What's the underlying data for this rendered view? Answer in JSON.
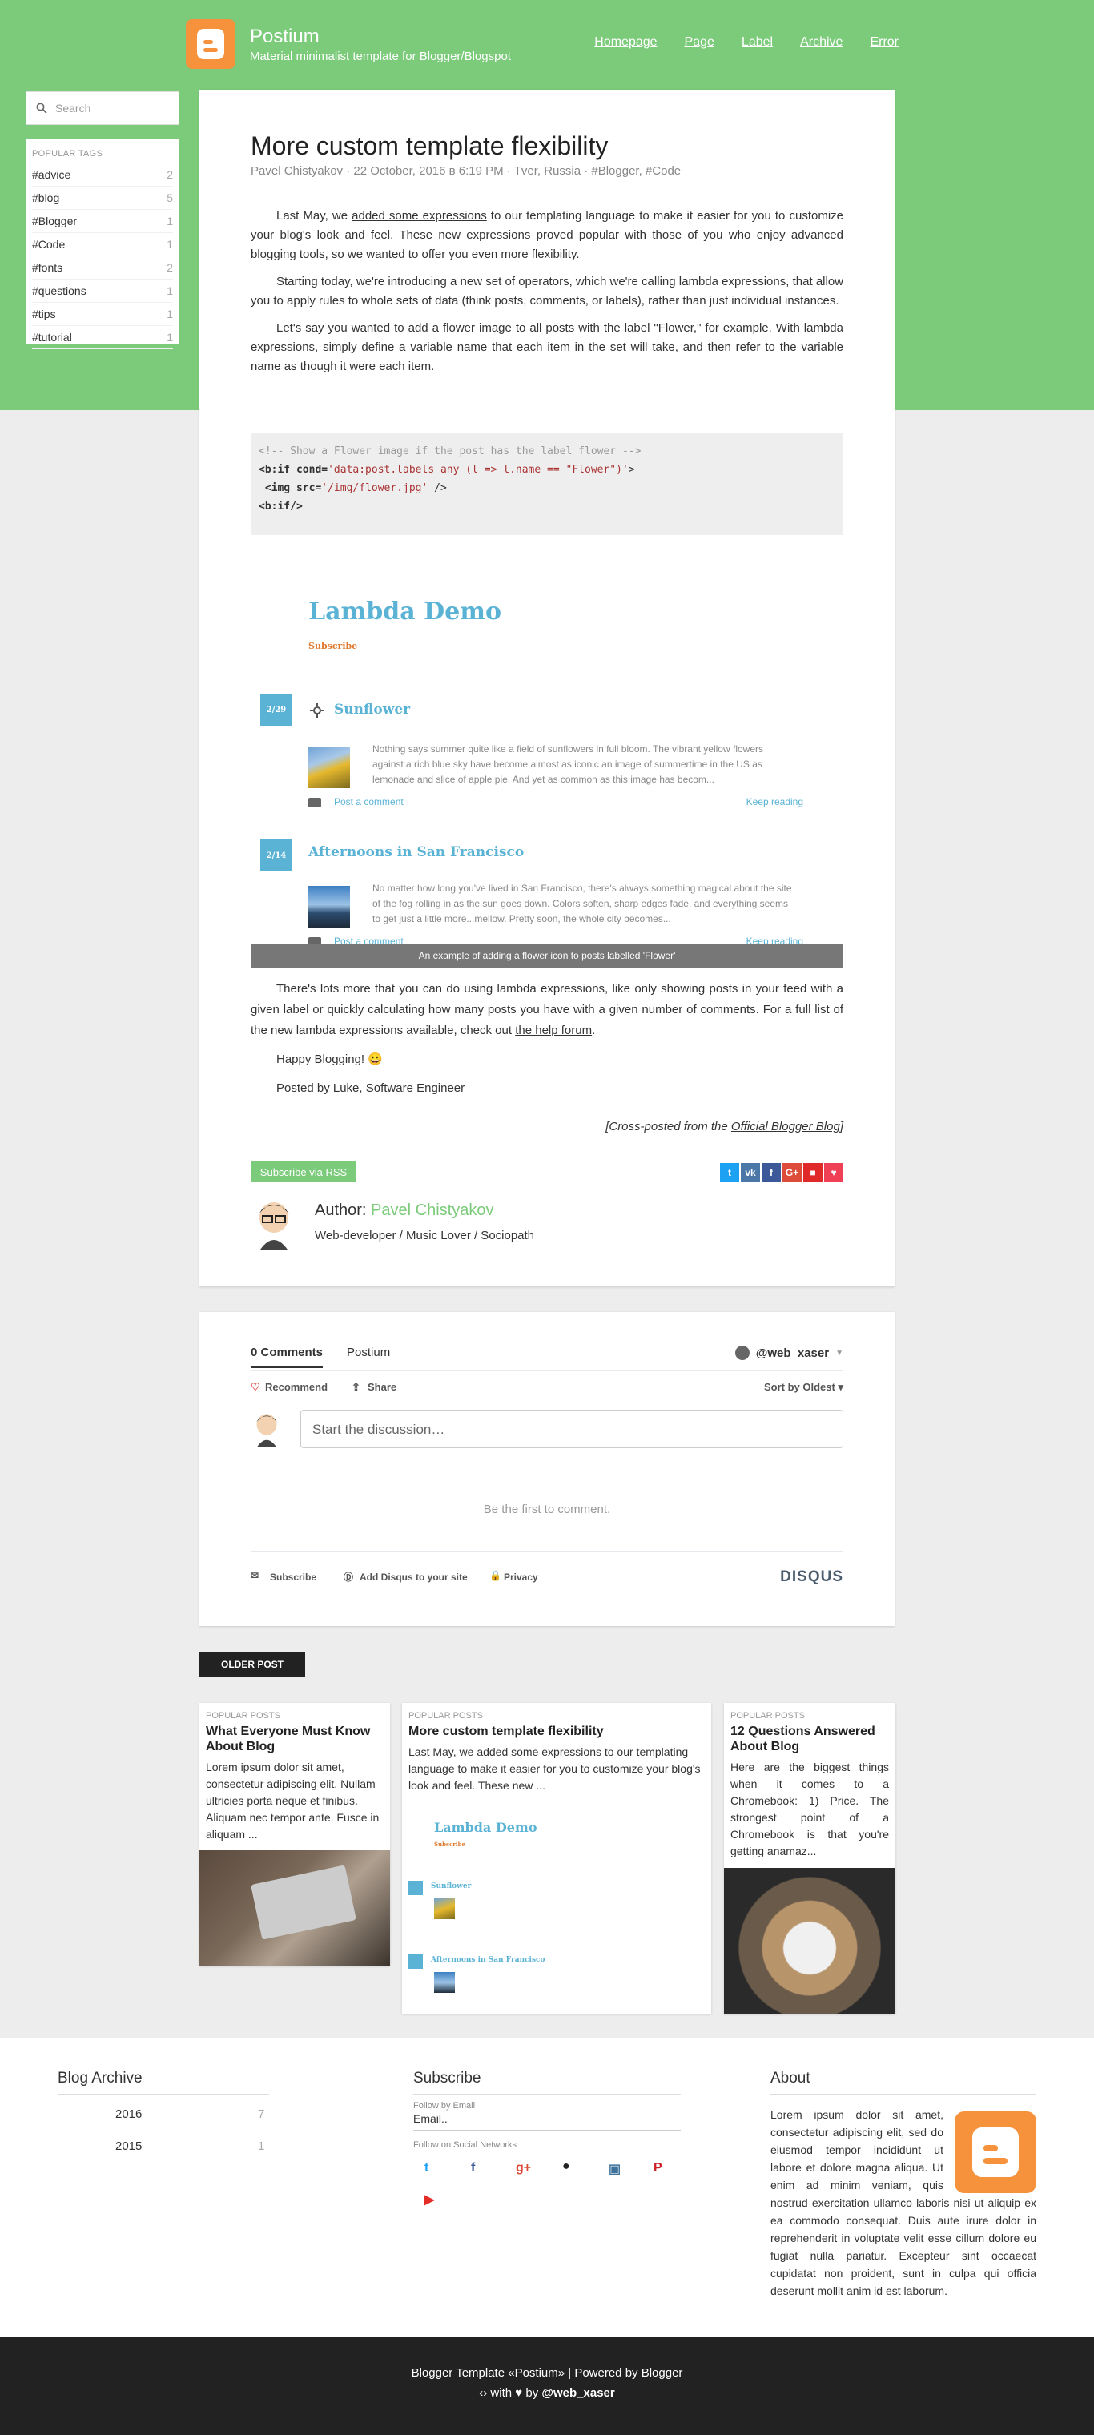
{
  "header": {
    "title": "Postium",
    "description": "Material minimalist template for Blogger/Blogspot",
    "nav": [
      "Homepage",
      "Page",
      "Label",
      "Archive",
      "Error"
    ]
  },
  "sidebar": {
    "search_placeholder": "Search",
    "tags_heading": "POPULAR TAGS",
    "tags": [
      {
        "name": "#advice",
        "count": "2"
      },
      {
        "name": "#blog",
        "count": "5"
      },
      {
        "name": "#Blogger",
        "count": "1"
      },
      {
        "name": "#Code",
        "count": "1"
      },
      {
        "name": "#fonts",
        "count": "2"
      },
      {
        "name": "#questions",
        "count": "1"
      },
      {
        "name": "#tips",
        "count": "1"
      },
      {
        "name": "#tutorial",
        "count": "1"
      }
    ]
  },
  "post": {
    "title": "More custom template flexibility",
    "meta": "Pavel Chistyakov · 22 October, 2016 в 6:19 PM · Tver, Russia · #Blogger, #Code",
    "p1_pre": "Last May, we ",
    "p1_link": "added some expressions",
    "p1_post": " to our templating language to make it easier for you to customize your blog's look and feel. These new expressions proved popular with those of you who enjoy advanced blogging tools, so we wanted to offer you even more flexibility.",
    "p2": "Starting today, we're introducing a new set of operators, which we're calling lambda expressions, that allow you to apply rules to whole sets of data (think posts, comments, or labels), rather than just individual instances.",
    "p3": "Let's say you wanted to add a flower image to all posts with the label \"Flower,\" for example. With lambda expressions, simply define a variable name that each item in the set will take, and then refer to the variable name as though it were each item.",
    "code": {
      "l1": "<!-- Show a Flower image if the post has the label flower -->",
      "l2_a": "<b:if cond=",
      "l2_b": "'data:post.labels any (l => l.name == \"Flower\")'",
      "l2_c": ">",
      "l3_a": " <img src=",
      "l3_b": "'/img/flower.jpg'",
      "l3_c": " />",
      "l4": "<b:if/>"
    },
    "demo": {
      "title": "Lambda Demo",
      "subscribe": "Subscribe",
      "items": [
        {
          "date": "2/29",
          "title": "Sunflower",
          "text": "Nothing says summer quite like a field of sunflowers in full bloom. The vibrant yellow flowers against a rich blue sky have become almost as iconic an image of summertime in the US as lemonade and slice of apple pie. And yet as common as this image has becom...",
          "comment": "Post a comment",
          "keep": "Keep reading"
        },
        {
          "date": "2/14",
          "title": "Afternoons in San Francisco",
          "text": "No matter how long you've lived in San Francisco, there's always something magical about the site of the fog rolling in as the sun goes down. Colors soften, sharp edges fade, and everything seems to get just a little more...mellow. Pretty soon, the whole city becomes...",
          "comment": "Post a comment",
          "keep": "Keep reading"
        }
      ],
      "caption": "An example of adding a flower icon to posts labelled 'Flower'"
    },
    "p4_pre": "There's lots more that you can do using lambda expressions, like only showing posts in your feed with a given label or quickly calculating how many posts you have with a given number of comments. For a full list of the new lambda expressions available, check out ",
    "p4_link": "the help forum",
    "p4_post": ".",
    "p5": "Happy Blogging! 😀",
    "p6": "Posted by Luke, Software Engineer",
    "cross_pre": "[Cross-posted from the ",
    "cross_link": "Official Blogger Blog",
    "cross_post": "]",
    "rss": "Subscribe via RSS",
    "author_label": "Author: ",
    "author_name": "Pavel Chistyakov",
    "author_bio": "Web-developer / Music Lover / Sociopath"
  },
  "comments": {
    "tab1": "0 Comments",
    "tab2": "Postium",
    "user": "@web_xaser",
    "recommend": "Recommend",
    "share": "Share",
    "sort": "Sort by Oldest",
    "placeholder": "Start the discussion…",
    "empty": "Be the first to comment.",
    "subscribe": "Subscribe",
    "add": "Add Disqus to your site",
    "privacy": "Privacy",
    "brand": "DISQUS"
  },
  "older": "OLDER POST",
  "popular": [
    {
      "label": "POPULAR POSTS",
      "title": "What Everyone Must Know About Blog",
      "text": "Lorem ipsum dolor sit amet, consectetur adipiscing elit. Nullam ultricies porta neque et finibus. Aliquam nec tempor ante. Fusce in aliquam ..."
    },
    {
      "label": "POPULAR POSTS",
      "title": "More custom template flexibility",
      "text": "Last May, we added some expressions to our templating language to make it easier for you to customize your blog's look and feel. These new ..."
    },
    {
      "label": "POPULAR POSTS",
      "title": "12 Questions Answered About Blog",
      "text": "Here are the biggest things when it comes to a Chromebook: 1) Price. The strongest point of a Chromebook is that you're getting anamaz..."
    }
  ],
  "footer": {
    "archive_title": "Blog Archive",
    "archive": [
      {
        "year": "2016",
        "count": "7"
      },
      {
        "year": "2015",
        "count": "1"
      }
    ],
    "subscribe_title": "Subscribe",
    "follow_email": "Follow by Email",
    "email_placeholder": "Email..",
    "follow_social": "Follow on Social Networks",
    "about_title": "About",
    "about_text": "Lorem ipsum dolor sit amet, consectetur adipiscing elit, sed do eiusmod tempor incididunt ut labore et dolore magna aliqua. Ut enim ad minim veniam, quis nostrud exercitation ullamco laboris nisi ut aliquip ex ea commodo consequat. Duis aute irure dolor in reprehenderit in voluptate velit esse cillum dolore eu fugiat nulla pariatur. Excepteur sint occaecat cupidatat non proident, sunt in culpa qui officia deserunt mollit anim id est laborum."
  },
  "bottom": {
    "line1": "Blogger Template «Postium» | Powered by Blogger",
    "with": " with ",
    "by": " by ",
    "handle": "@web_xaser"
  },
  "colors": {
    "accent": "#7bcb7b",
    "brand": "#f6913c",
    "demo_blue": "#5ab3d4"
  }
}
